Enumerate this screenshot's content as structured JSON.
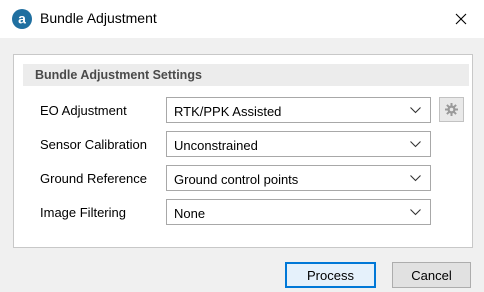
{
  "window": {
    "title": "Bundle Adjustment",
    "app_icon": "a-circle-logo-icon",
    "close_icon": "close-icon"
  },
  "panel": {
    "header": "Bundle Adjustment Settings",
    "rows": [
      {
        "label": "EO Adjustment",
        "value": "RTK/PPK Assisted"
      },
      {
        "label": "Sensor Calibration",
        "value": "Unconstrained"
      },
      {
        "label": "Ground Reference",
        "value": "Ground control points"
      },
      {
        "label": "Image Filtering",
        "value": "None"
      }
    ],
    "settings_icon": "gear-icon"
  },
  "buttons": {
    "process": "Process",
    "cancel": "Cancel"
  },
  "colors": {
    "accent": "#0078d7",
    "app_icon": "#1f6fa0"
  }
}
